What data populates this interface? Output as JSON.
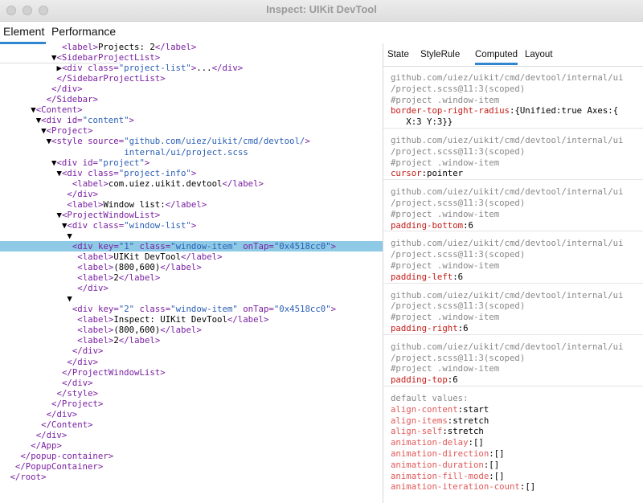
{
  "window": {
    "title": "Inspect: UIKit DevTool"
  },
  "main_tabs": [
    "Element",
    "Performance"
  ],
  "right_tabs": [
    "State",
    "StyleRule",
    "Computed",
    "Layout"
  ],
  "tree": [
    {
      "indent": 11,
      "tok": [
        [
          "p",
          "<"
        ],
        [
          "tag",
          "label"
        ],
        [
          "p",
          ">"
        ],
        [
          "tx",
          "Projects: 2"
        ],
        [
          "p",
          "</"
        ],
        [
          "tag",
          "label"
        ],
        [
          "p",
          ">"
        ]
      ]
    },
    {
      "indent": 10,
      "tog": "▼",
      "tok": [
        [
          "p",
          "<"
        ],
        [
          "tag",
          "SidebarProjectList"
        ],
        [
          "p",
          ">"
        ]
      ]
    },
    {
      "indent": 11,
      "tog": "▶",
      "tok": [
        [
          "p",
          "<"
        ],
        [
          "tag",
          "div"
        ],
        [
          "an",
          " class="
        ],
        [
          "av",
          "\"project-list\""
        ],
        [
          "p",
          ">"
        ],
        [
          "tx",
          "..."
        ],
        [
          "p",
          "</"
        ],
        [
          "tag",
          "div"
        ],
        [
          "p",
          ">"
        ]
      ]
    },
    {
      "indent": 10,
      "tok": [
        [
          "p",
          "</"
        ],
        [
          "tag",
          "SidebarProjectList"
        ],
        [
          "p",
          ">"
        ]
      ]
    },
    {
      "indent": 9,
      "tok": [
        [
          "p",
          "</"
        ],
        [
          "tag",
          "div"
        ],
        [
          "p",
          ">"
        ]
      ]
    },
    {
      "indent": 8,
      "tok": [
        [
          "p",
          "</"
        ],
        [
          "tag",
          "Sidebar"
        ],
        [
          "p",
          ">"
        ]
      ]
    },
    {
      "indent": 6,
      "tog": "▼",
      "tok": [
        [
          "p",
          "<"
        ],
        [
          "tag",
          "Content"
        ],
        [
          "p",
          ">"
        ]
      ]
    },
    {
      "indent": 7,
      "tog": "▼",
      "tok": [
        [
          "p",
          "<"
        ],
        [
          "tag",
          "div"
        ],
        [
          "an",
          " id="
        ],
        [
          "av",
          "\"content\""
        ],
        [
          "p",
          ">"
        ]
      ]
    },
    {
      "indent": 8,
      "tog": "▼",
      "tok": [
        [
          "p",
          "<"
        ],
        [
          "tag",
          "Project"
        ],
        [
          "p",
          ">"
        ]
      ]
    },
    {
      "indent": 9,
      "tog": "▼",
      "tok": [
        [
          "p",
          "<"
        ],
        [
          "tag",
          "style"
        ],
        [
          "an",
          " source="
        ],
        [
          "av",
          "\"github.com/uiez/uikit/cmd/devtool/"
        ],
        [
          "p",
          ">"
        ]
      ]
    },
    {
      "indent": 23,
      "tok": [
        [
          "av",
          "internal/ui/project.scss"
        ]
      ]
    },
    {
      "indent": 10,
      "tog": "▼",
      "tok": [
        [
          "p",
          "<"
        ],
        [
          "tag",
          "div"
        ],
        [
          "an",
          " id="
        ],
        [
          "av",
          "\"project\""
        ],
        [
          "p",
          ">"
        ]
      ]
    },
    {
      "indent": 11,
      "tog": "▼",
      "tok": [
        [
          "p",
          "<"
        ],
        [
          "tag",
          "div"
        ],
        [
          "an",
          " class="
        ],
        [
          "av",
          "\"project-info\""
        ],
        [
          "p",
          ">"
        ]
      ]
    },
    {
      "indent": 13,
      "tok": [
        [
          "p",
          "<"
        ],
        [
          "tag",
          "label"
        ],
        [
          "p",
          ">"
        ],
        [
          "tx",
          "com.uiez.uikit.devtool"
        ],
        [
          "p",
          "</"
        ],
        [
          "tag",
          "label"
        ],
        [
          "p",
          ">"
        ]
      ]
    },
    {
      "indent": 12,
      "tok": [
        [
          "p",
          "</"
        ],
        [
          "tag",
          "div"
        ],
        [
          "p",
          ">"
        ]
      ]
    },
    {
      "indent": 12,
      "tok": [
        [
          "p",
          "<"
        ],
        [
          "tag",
          "label"
        ],
        [
          "p",
          ">"
        ],
        [
          "tx",
          "Window list:"
        ],
        [
          "p",
          "</"
        ],
        [
          "tag",
          "label"
        ],
        [
          "p",
          ">"
        ]
      ]
    },
    {
      "indent": 11,
      "tog": "▼",
      "tok": [
        [
          "p",
          "<"
        ],
        [
          "tag",
          "ProjectWindowList"
        ],
        [
          "p",
          ">"
        ]
      ]
    },
    {
      "indent": 12,
      "tog": "▼",
      "tok": [
        [
          "p",
          "<"
        ],
        [
          "tag",
          "div"
        ],
        [
          "an",
          " class="
        ],
        [
          "av",
          "\"window-list\""
        ],
        [
          "p",
          ">"
        ]
      ]
    },
    {
      "indent": 13,
      "tog": "▼",
      "tok": []
    },
    {
      "indent": 13,
      "sel": true,
      "tok": [
        [
          "p",
          "<"
        ],
        [
          "tag",
          "div"
        ],
        [
          "an",
          " key="
        ],
        [
          "av",
          "\"1\""
        ],
        [
          "an",
          " class="
        ],
        [
          "av",
          "\"window-item\""
        ],
        [
          "an",
          " onTap="
        ],
        [
          "av",
          "\"0x4518cc0\""
        ],
        [
          "p",
          ">"
        ]
      ]
    },
    {
      "indent": 14,
      "tok": [
        [
          "p",
          "<"
        ],
        [
          "tag",
          "label"
        ],
        [
          "p",
          ">"
        ],
        [
          "tx",
          "UIKit DevTool"
        ],
        [
          "p",
          "</"
        ],
        [
          "tag",
          "label"
        ],
        [
          "p",
          ">"
        ]
      ]
    },
    {
      "indent": 14,
      "tok": [
        [
          "p",
          "<"
        ],
        [
          "tag",
          "label"
        ],
        [
          "p",
          ">"
        ],
        [
          "tx",
          "(800,600)"
        ],
        [
          "p",
          "</"
        ],
        [
          "tag",
          "label"
        ],
        [
          "p",
          ">"
        ]
      ]
    },
    {
      "indent": 14,
      "tok": [
        [
          "p",
          "<"
        ],
        [
          "tag",
          "label"
        ],
        [
          "p",
          ">"
        ],
        [
          "tx",
          "2"
        ],
        [
          "p",
          "</"
        ],
        [
          "tag",
          "label"
        ],
        [
          "p",
          ">"
        ]
      ]
    },
    {
      "indent": 14,
      "tok": [
        [
          "p",
          "</"
        ],
        [
          "tag",
          "div"
        ],
        [
          "p",
          ">"
        ]
      ]
    },
    {
      "indent": 13,
      "tog": "▼",
      "tok": []
    },
    {
      "indent": 13,
      "tok": [
        [
          "p",
          "<"
        ],
        [
          "tag",
          "div"
        ],
        [
          "an",
          " key="
        ],
        [
          "av",
          "\"2\""
        ],
        [
          "an",
          " class="
        ],
        [
          "av",
          "\"window-item\""
        ],
        [
          "an",
          " onTap="
        ],
        [
          "av",
          "\"0x4518cc0\""
        ],
        [
          "p",
          ">"
        ]
      ]
    },
    {
      "indent": 14,
      "tok": [
        [
          "p",
          "<"
        ],
        [
          "tag",
          "label"
        ],
        [
          "p",
          ">"
        ],
        [
          "tx",
          "Inspect: UIKit DevTool"
        ],
        [
          "p",
          "</"
        ],
        [
          "tag",
          "label"
        ],
        [
          "p",
          ">"
        ]
      ]
    },
    {
      "indent": 14,
      "tok": [
        [
          "p",
          "<"
        ],
        [
          "tag",
          "label"
        ],
        [
          "p",
          ">"
        ],
        [
          "tx",
          "(800,600)"
        ],
        [
          "p",
          "</"
        ],
        [
          "tag",
          "label"
        ],
        [
          "p",
          ">"
        ]
      ]
    },
    {
      "indent": 14,
      "tok": [
        [
          "p",
          "<"
        ],
        [
          "tag",
          "label"
        ],
        [
          "p",
          ">"
        ],
        [
          "tx",
          "2"
        ],
        [
          "p",
          "</"
        ],
        [
          "tag",
          "label"
        ],
        [
          "p",
          ">"
        ]
      ]
    },
    {
      "indent": 13,
      "tok": [
        [
          "p",
          "</"
        ],
        [
          "tag",
          "div"
        ],
        [
          "p",
          ">"
        ]
      ]
    },
    {
      "indent": 12,
      "tok": [
        [
          "p",
          "</"
        ],
        [
          "tag",
          "div"
        ],
        [
          "p",
          ">"
        ]
      ]
    },
    {
      "indent": 11,
      "tok": [
        [
          "p",
          "</"
        ],
        [
          "tag",
          "ProjectWindowList"
        ],
        [
          "p",
          ">"
        ]
      ]
    },
    {
      "indent": 11,
      "tok": [
        [
          "p",
          "</"
        ],
        [
          "tag",
          "div"
        ],
        [
          "p",
          ">"
        ]
      ]
    },
    {
      "indent": 10,
      "tok": [
        [
          "p",
          "</"
        ],
        [
          "tag",
          "style"
        ],
        [
          "p",
          ">"
        ]
      ]
    },
    {
      "indent": 9,
      "tok": [
        [
          "p",
          "</"
        ],
        [
          "tag",
          "Project"
        ],
        [
          "p",
          ">"
        ]
      ]
    },
    {
      "indent": 8,
      "tok": [
        [
          "p",
          "</"
        ],
        [
          "tag",
          "div"
        ],
        [
          "p",
          ">"
        ]
      ]
    },
    {
      "indent": 7,
      "tok": [
        [
          "p",
          "</"
        ],
        [
          "tag",
          "Content"
        ],
        [
          "p",
          ">"
        ]
      ]
    },
    {
      "indent": 6,
      "tok": [
        [
          "p",
          "</"
        ],
        [
          "tag",
          "div"
        ],
        [
          "p",
          ">"
        ]
      ]
    },
    {
      "indent": 5,
      "tok": [
        [
          "p",
          "</"
        ],
        [
          "tag",
          "App"
        ],
        [
          "p",
          ">"
        ]
      ]
    },
    {
      "indent": 3,
      "tok": [
        [
          "p",
          "</"
        ],
        [
          "tag",
          "popup-container"
        ],
        [
          "p",
          ">"
        ]
      ]
    },
    {
      "indent": 2,
      "tok": [
        [
          "p",
          "</"
        ],
        [
          "tag",
          "PopupContainer"
        ],
        [
          "p",
          ">"
        ]
      ]
    },
    {
      "indent": 1,
      "tok": [
        [
          "p",
          "</"
        ],
        [
          "tag",
          "root"
        ],
        [
          "p",
          ">"
        ]
      ]
    }
  ],
  "rules": [
    {
      "src": [
        "github.com/uiez/uikit/cmd/devtool/internal/ui",
        "/project.scss@11:3(scoped)"
      ],
      "sel": "#project .window-item",
      "decl": [
        [
          "border-top-right-radius",
          "{Unified:true Axes:{"
        ],
        [
          "",
          "   X:3 Y:3}}"
        ]
      ]
    },
    {
      "src": [
        "github.com/uiez/uikit/cmd/devtool/internal/ui",
        "/project.scss@11:3(scoped)"
      ],
      "sel": "#project .window-item",
      "decl": [
        [
          "cursor",
          "pointer"
        ]
      ]
    },
    {
      "src": [
        "github.com/uiez/uikit/cmd/devtool/internal/ui",
        "/project.scss@11:3(scoped)"
      ],
      "sel": "#project .window-item",
      "decl": [
        [
          "padding-bottom",
          "6"
        ]
      ]
    },
    {
      "src": [
        "github.com/uiez/uikit/cmd/devtool/internal/ui",
        "/project.scss@11:3(scoped)"
      ],
      "sel": "#project .window-item",
      "decl": [
        [
          "padding-left",
          "6"
        ]
      ]
    },
    {
      "src": [
        "github.com/uiez/uikit/cmd/devtool/internal/ui",
        "/project.scss@11:3(scoped)"
      ],
      "sel": "#project .window-item",
      "decl": [
        [
          "padding-right",
          "6"
        ]
      ]
    },
    {
      "src": [
        "github.com/uiez/uikit/cmd/devtool/internal/ui",
        "/project.scss@11:3(scoped)"
      ],
      "sel": "#project .window-item",
      "decl": [
        [
          "padding-top",
          "6"
        ]
      ]
    }
  ],
  "defaults": {
    "header": "default values:",
    "decl": [
      [
        "align-content",
        "start"
      ],
      [
        "align-items",
        "stretch"
      ],
      [
        "align-self",
        "stretch"
      ],
      [
        "animation-delay",
        "[]"
      ],
      [
        "animation-direction",
        "[]"
      ],
      [
        "animation-duration",
        "[]"
      ],
      [
        "animation-fill-mode",
        "[]"
      ],
      [
        "animation-iteration-count",
        "[]"
      ]
    ]
  }
}
